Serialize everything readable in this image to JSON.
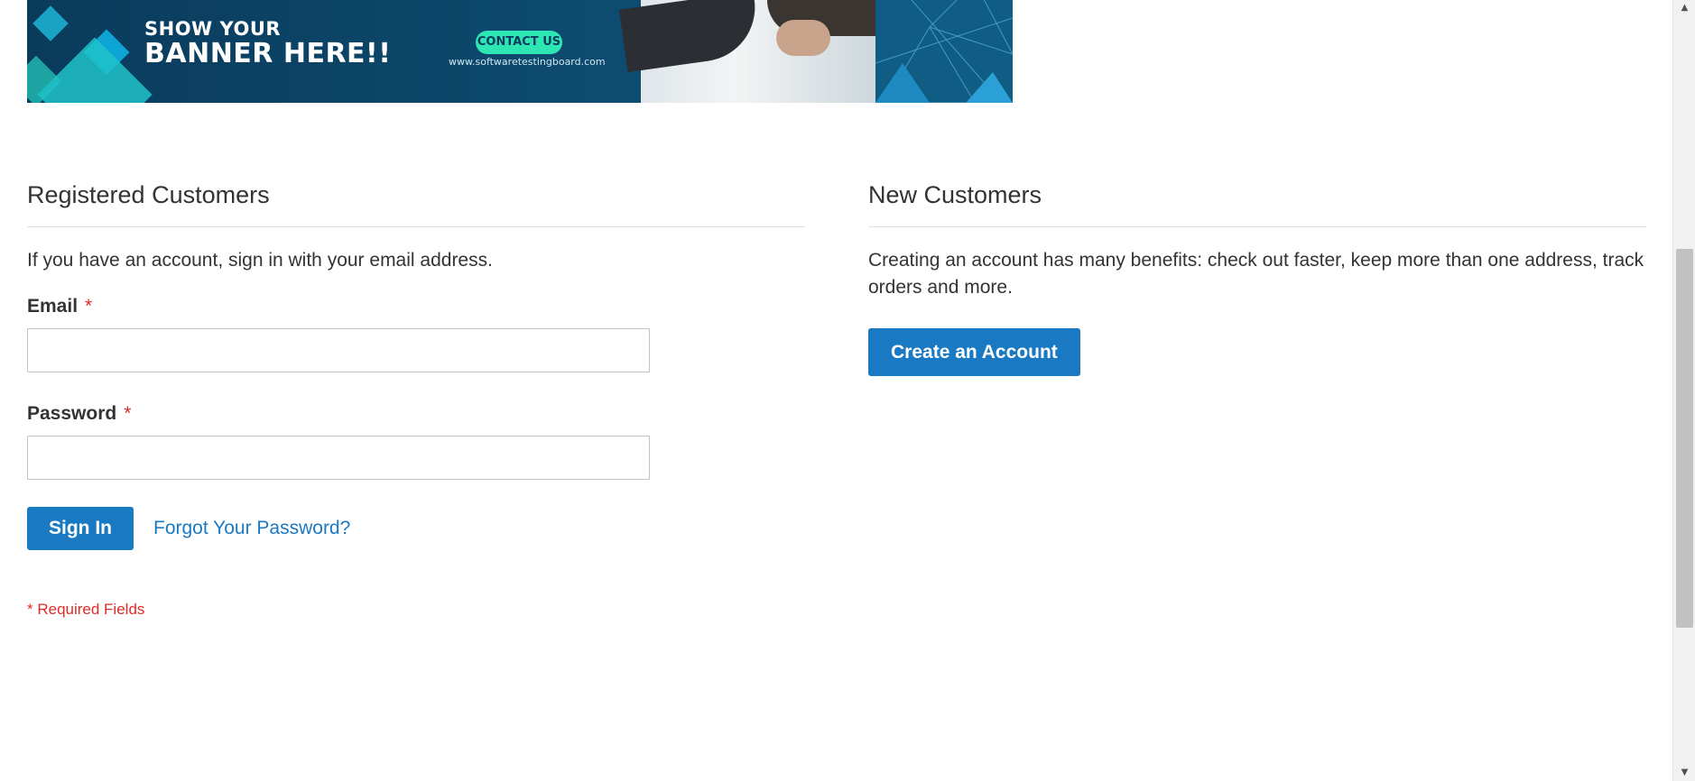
{
  "banner": {
    "line1": "SHOW YOUR",
    "line2": "BANNER HERE!!",
    "contact_label": "CONTACT US",
    "site": "www.softwaretestingboard.com"
  },
  "registered": {
    "title": "Registered Customers",
    "intro": "If you have an account, sign in with your email address.",
    "email_label": "Email",
    "email_value": "",
    "password_label": "Password",
    "password_value": "",
    "required_mark": "*",
    "sign_in_label": "Sign In",
    "forgot_label": "Forgot Your Password?",
    "required_note": "* Required Fields"
  },
  "new_customers": {
    "title": "New Customers",
    "intro": "Creating an account has many benefits: check out faster, keep more than one address, track orders and more.",
    "create_label": "Create an Account"
  },
  "colors": {
    "primary": "#1979c3",
    "required": "#e02b27",
    "text": "#333333"
  },
  "scrollbar": {
    "up_icon": "triangle-up-icon",
    "down_icon": "triangle-down-icon"
  }
}
